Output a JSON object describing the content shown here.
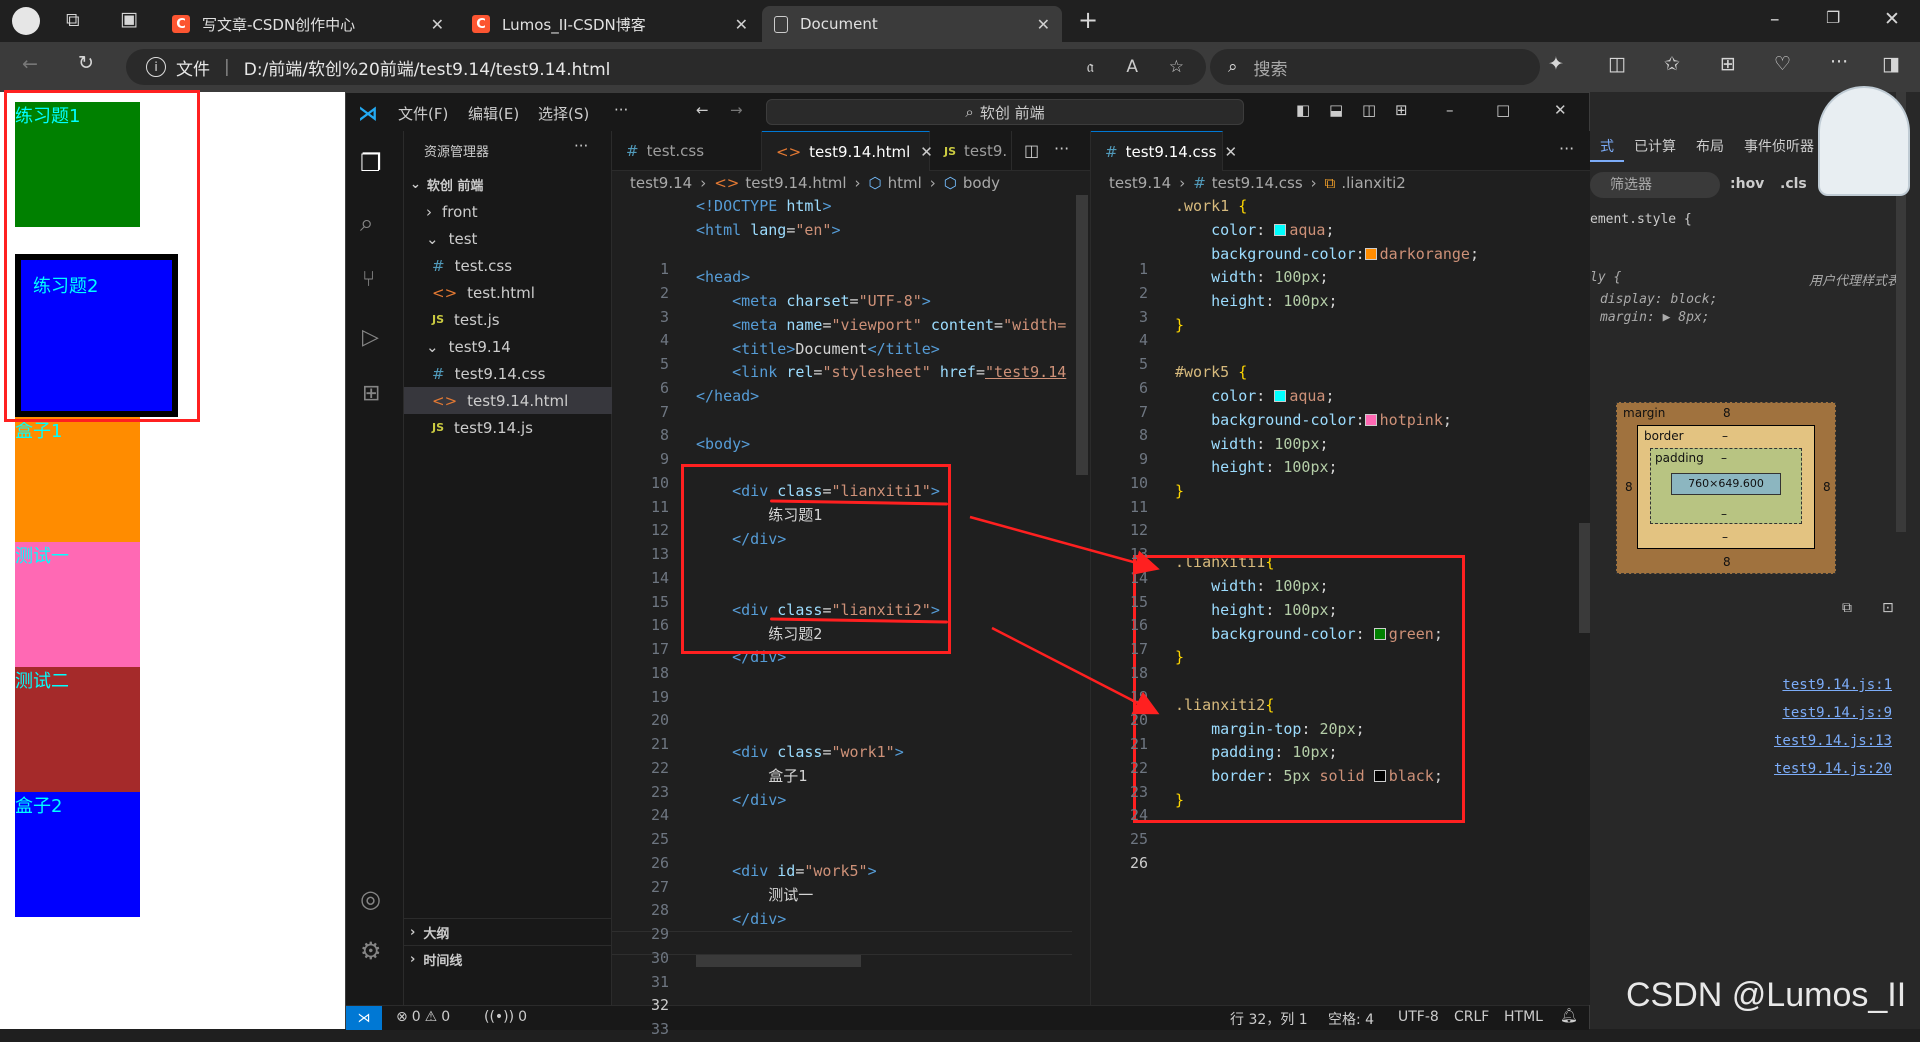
{
  "browser": {
    "tabs": [
      {
        "title": "写文章-CSDN创作中心",
        "icon_letter": "C"
      },
      {
        "title": "Lumos_II-CSDN博客",
        "icon_letter": "C"
      },
      {
        "title": "Document",
        "icon_letter": ""
      }
    ],
    "address": {
      "scheme_label": "文件",
      "url": "D:/前端/软创%20前端/test9.14/test9.14.html"
    },
    "search_placeholder": "搜索"
  },
  "page": {
    "boxes": [
      {
        "label": "练习题1",
        "color": "#008000"
      },
      {
        "label": "练习题2",
        "color": "#0000ff"
      },
      {
        "label": "盒子1",
        "color": "#ff8c00"
      },
      {
        "label": "测试一",
        "color": "#ff69b4"
      },
      {
        "label": "测试二",
        "color": "#a52a2a"
      },
      {
        "label": "盒子2",
        "color": "#0000ff"
      }
    ]
  },
  "vscode": {
    "menu": [
      "文件(F)",
      "编辑(E)",
      "选择(S)",
      "···"
    ],
    "command_center": "软创 前端",
    "explorer": {
      "title": "资源管理器",
      "root": "软创 前端",
      "items": [
        {
          "label": "front",
          "kind": "folder-closed"
        },
        {
          "label": "test",
          "kind": "folder-open"
        },
        {
          "label": "test.css",
          "kind": "css"
        },
        {
          "label": "test.html",
          "kind": "html"
        },
        {
          "label": "test.js",
          "kind": "js"
        },
        {
          "label": "test9.14",
          "kind": "folder-open"
        },
        {
          "label": "test9.14.css",
          "kind": "css"
        },
        {
          "label": "test9.14.html",
          "kind": "html"
        },
        {
          "label": "test9.14.js",
          "kind": "js"
        }
      ],
      "outline": "大纲",
      "timeline": "时间线"
    },
    "editor1": {
      "tabs": [
        "test.css",
        "test9.14.html",
        "test9."
      ],
      "breadcrumbs": [
        "test9.14",
        "test9.14.html",
        "html",
        "body"
      ],
      "line_numbers": [
        "1",
        "2",
        "3",
        "4",
        "5",
        "6",
        "7",
        "8",
        "9",
        "10",
        "11",
        "12",
        "13",
        "14",
        "15",
        "16",
        "17",
        "18",
        "19",
        "20",
        "21",
        "22",
        "23",
        "24",
        "25",
        "26",
        "27",
        "28",
        "29",
        "30",
        "31",
        "32",
        "33"
      ],
      "current_line": "32"
    },
    "editor2": {
      "tabs": [
        "test9.14.css"
      ],
      "breadcrumbs": [
        "test9.14",
        "test9.14.css",
        ".lianxiti2"
      ],
      "line_numbers": [
        "1",
        "2",
        "3",
        "4",
        "5",
        "6",
        "7",
        "8",
        "9",
        "10",
        "11",
        "12",
        "13",
        "14",
        "15",
        "16",
        "17",
        "18",
        "19",
        "20",
        "21",
        "22",
        "23",
        "24",
        "25",
        "26"
      ],
      "current_line": "26"
    },
    "status": {
      "errors": "0",
      "warnings": "0",
      "ports": "0",
      "position": "行 32，列 1",
      "spaces": "空格: 4",
      "encoding": "UTF-8",
      "eol": "CRLF",
      "language": "HTML"
    }
  },
  "devtools": {
    "tabs": [
      "式",
      "已计算",
      "布局",
      "事件侦听器"
    ],
    "filter_placeholder": "筛选器",
    "hov": ":hov",
    "cls": ".cls",
    "element_style": "ement.style {",
    "ua_rule": "ly {",
    "ua_label": "用户代理样式表",
    "ua_props": [
      "display: block;",
      "margin: ▶ 8px;"
    ],
    "box_model": {
      "margin_label": "margin",
      "margin": "8",
      "border_label": "border",
      "border": "–",
      "padding_label": "padding",
      "padding": "–",
      "content": "760×649.600"
    },
    "links": [
      "test9.14.js:1",
      "test9.14.js:9",
      "test9.14.js:13",
      "test9.14.js:20"
    ]
  },
  "watermark": "CSDN @Lumos_II"
}
